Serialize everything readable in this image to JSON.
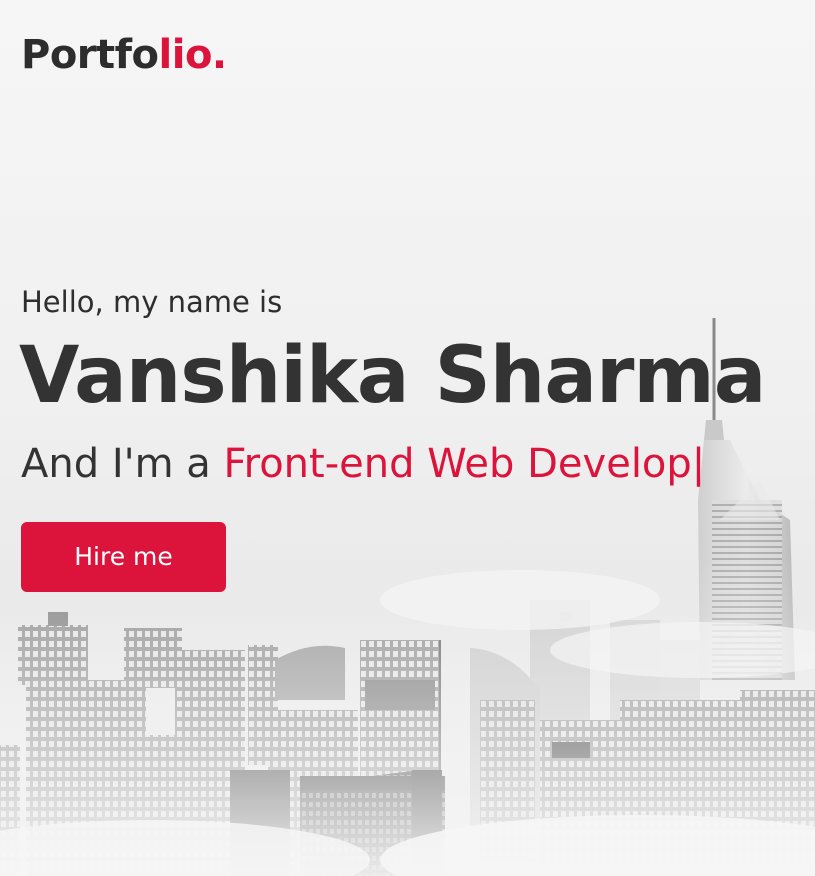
{
  "header": {
    "logo_main": "Portfo",
    "logo_accent": "lio."
  },
  "hero": {
    "intro": "Hello, my name is",
    "name": "Vanshika Sharma",
    "role_prefix": "And I'm a ",
    "role_typed": "Front-end Web Develop",
    "cursor": "|",
    "cta_label": "Hire me"
  },
  "colors": {
    "accent": "#dc143c",
    "text": "#333333",
    "background": "#f3f3f3"
  },
  "background_image": "grayscale city skyline with fog"
}
